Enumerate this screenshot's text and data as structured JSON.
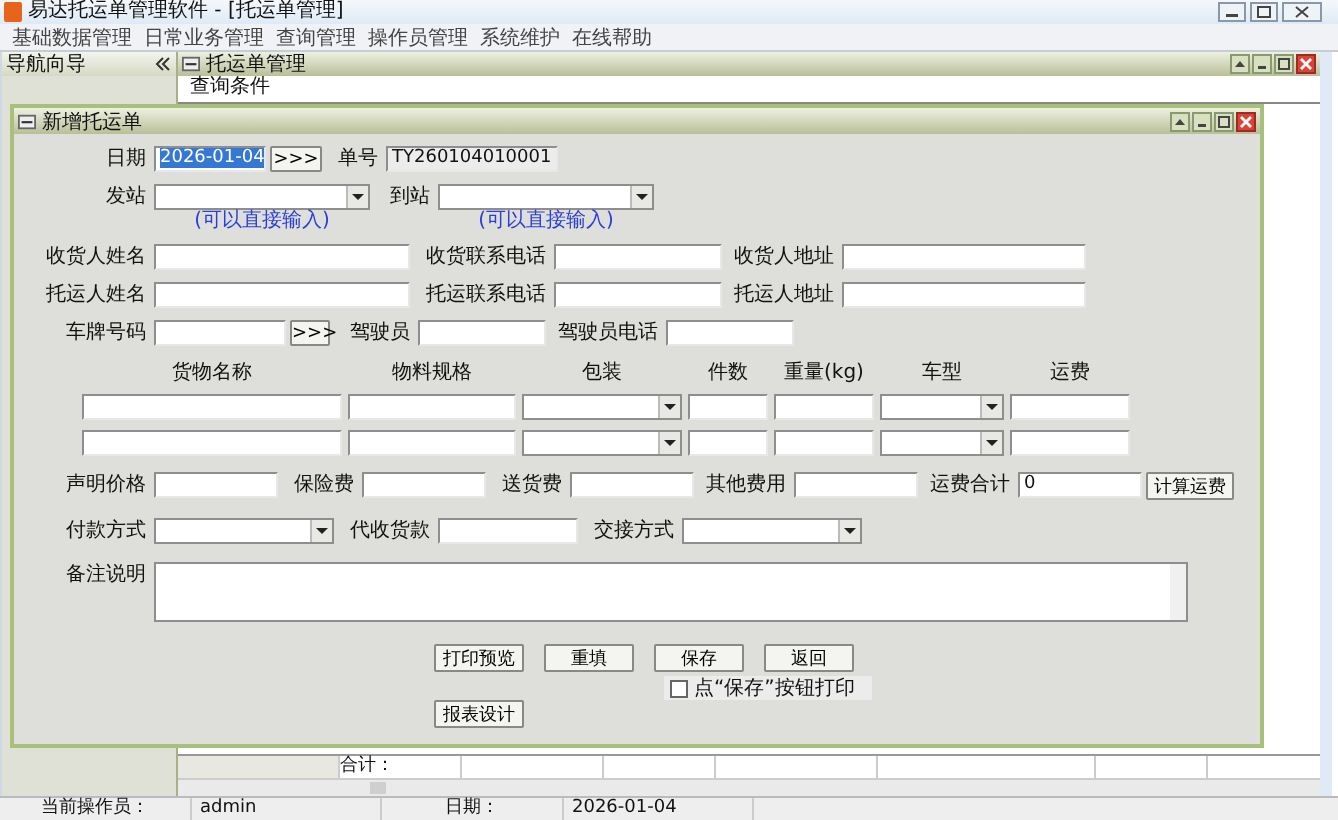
{
  "app_title": "易达托运单管理软件 - [托运单管理]",
  "menu": [
    "基础数据管理",
    "日常业务管理",
    "查询管理",
    "操作员管理",
    "系统维护",
    "在线帮助"
  ],
  "nav": {
    "title": "导航向导"
  },
  "mdi_window": {
    "title": "托运单管理",
    "tab": "查询条件"
  },
  "dialog": {
    "title": "新增托运单",
    "lines": [
      {
        "items": [
          {
            "kind": "label",
            "text": "日期"
          },
          {
            "kind": "input",
            "value": "2026-01-04",
            "highlighted": true
          },
          {
            "kind": "button",
            "text": ">>>"
          },
          {
            "kind": "label",
            "text": "单号"
          },
          {
            "kind": "readonly",
            "value": "TY260104010001"
          }
        ]
      },
      {
        "items": [
          {
            "kind": "label",
            "text": "发站"
          },
          {
            "kind": "select",
            "hint": "(可以直接输入)"
          },
          {
            "kind": "label",
            "text": "到站"
          },
          {
            "kind": "select",
            "hint": "(可以直接输入)"
          }
        ]
      },
      {
        "items": [
          {
            "kind": "label",
            "text": "收货人姓名"
          },
          {
            "kind": "input"
          },
          {
            "kind": "label",
            "text": "收货联系电话"
          },
          {
            "kind": "input"
          },
          {
            "kind": "label",
            "text": "收货人地址"
          },
          {
            "kind": "input"
          }
        ]
      },
      {
        "items": [
          {
            "kind": "label",
            "text": "托运人姓名"
          },
          {
            "kind": "input"
          },
          {
            "kind": "label",
            "text": "托运联系电话"
          },
          {
            "kind": "input"
          },
          {
            "kind": "label",
            "text": "托运人地址"
          },
          {
            "kind": "input"
          }
        ]
      },
      {
        "items": [
          {
            "kind": "label",
            "text": "车牌号码"
          },
          {
            "kind": "input"
          },
          {
            "kind": "button",
            "text": ">>>"
          },
          {
            "kind": "label",
            "text": "驾驶员"
          },
          {
            "kind": "input"
          },
          {
            "kind": "label",
            "text": "驾驶员电话"
          },
          {
            "kind": "input"
          }
        ]
      }
    ],
    "goods": {
      "columns": [
        {
          "label": "货物名称",
          "kind": "input"
        },
        {
          "label": "物料规格",
          "kind": "input"
        },
        {
          "label": "包装",
          "kind": "select"
        },
        {
          "label": "件数",
          "kind": "input"
        },
        {
          "label": "重量(kg)",
          "kind": "input"
        },
        {
          "label": "车型",
          "kind": "select"
        },
        {
          "label": "运费",
          "kind": "input"
        }
      ],
      "rows": [
        {
          "kind": "entry"
        },
        {
          "kind": "entry"
        }
      ]
    },
    "lines2": [
      {
        "items": [
          {
            "kind": "label",
            "text": "声明价格"
          },
          {
            "kind": "input"
          },
          {
            "kind": "label",
            "text": "保险费"
          },
          {
            "kind": "input"
          },
          {
            "kind": "label",
            "text": "送货费"
          },
          {
            "kind": "input"
          },
          {
            "kind": "label",
            "text": "其他费用"
          },
          {
            "kind": "input"
          },
          {
            "kind": "label",
            "text": "运费合计"
          },
          {
            "kind": "input",
            "value": "0"
          },
          {
            "kind": "button",
            "text": "计算运费"
          }
        ]
      },
      {
        "items": [
          {
            "kind": "label",
            "text": "付款方式"
          },
          {
            "kind": "select"
          },
          {
            "kind": "label",
            "text": "代收货款"
          },
          {
            "kind": "input"
          },
          {
            "kind": "label",
            "text": "交接方式"
          },
          {
            "kind": "select"
          }
        ]
      },
      {
        "items": [
          {
            "kind": "label",
            "text": "备注说明"
          },
          {
            "kind": "textarea"
          }
        ]
      }
    ],
    "buttons": [
      "打印预览",
      "重填",
      "保存",
      "返回"
    ],
    "print_on_save": {
      "label": "点“保存”按钮打印",
      "checked": false
    },
    "design_button": "报表设计"
  },
  "grid": {
    "total_label": "合计："
  },
  "status_bar": [
    "当前操作员：",
    "admin",
    "日期：",
    "2026-01-04"
  ]
}
